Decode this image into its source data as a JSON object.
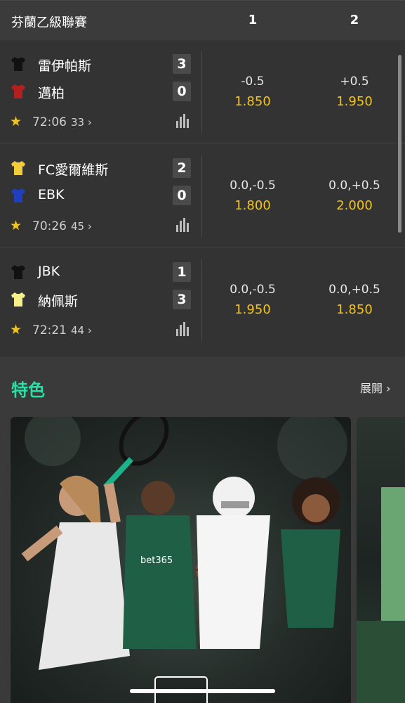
{
  "league": {
    "title": "芬蘭乙級聯賽",
    "col1": "1",
    "col2": "2"
  },
  "matches": [
    {
      "home": {
        "name": "雷伊帕斯",
        "score": "3",
        "shirt_color": "#111111"
      },
      "away": {
        "name": "邁柏",
        "score": "0",
        "shirt_color": "#b3201f"
      },
      "clock": "72:06",
      "more": "33",
      "odds1": {
        "line": "-0.5",
        "price": "1.850"
      },
      "odds2": {
        "line": "+0.5",
        "price": "1.950"
      }
    },
    {
      "home": {
        "name": "FC愛爾維斯",
        "score": "2",
        "shirt_color": "#f3cc3a"
      },
      "away": {
        "name": "EBK",
        "score": "0",
        "shirt_color": "#1f3fbf"
      },
      "clock": "70:26",
      "more": "45",
      "odds1": {
        "line": "0.0,-0.5",
        "price": "1.800"
      },
      "odds2": {
        "line": "0.0,+0.5",
        "price": "2.000"
      }
    },
    {
      "home": {
        "name": "JBK",
        "score": "1",
        "shirt_color": "#111111"
      },
      "away": {
        "name": "納佩斯",
        "score": "3",
        "shirt_color": "#f5f08a"
      },
      "clock": "72:21",
      "more": "44",
      "odds1": {
        "line": "0.0,-0.5",
        "price": "1.950"
      },
      "odds2": {
        "line": "0.0,+0.5",
        "price": "1.850"
      }
    }
  ],
  "featured": {
    "title": "特色",
    "expand_label": "展開 ›",
    "promo_text": "bet365"
  },
  "icons": {
    "star": "star-icon",
    "stats": "stats-icon",
    "chevron": "chevron-right-icon",
    "play": "play-icon"
  },
  "colors": {
    "accent_green": "#27e0a6",
    "odds_yellow": "#f5c518",
    "background": "#333333"
  }
}
